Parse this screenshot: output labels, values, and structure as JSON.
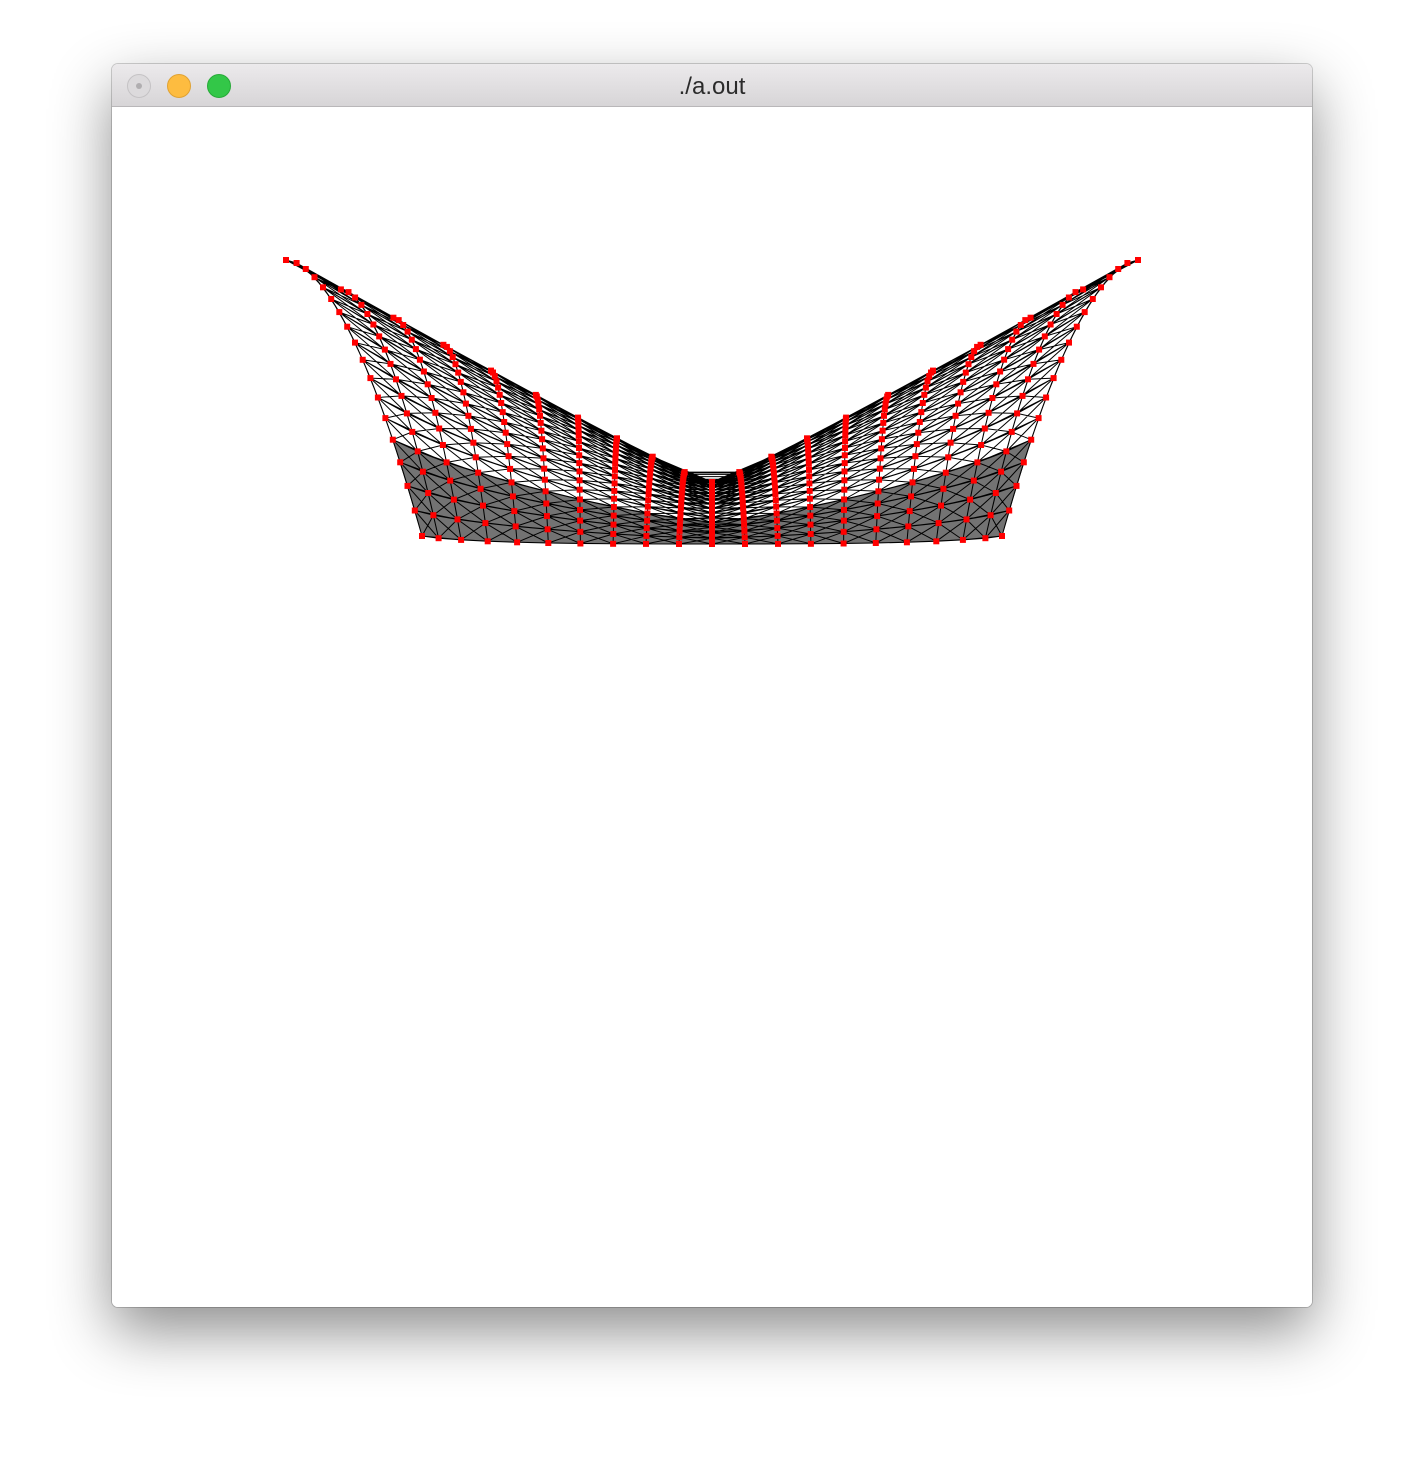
{
  "window": {
    "title": "./a.out"
  },
  "canvas": {
    "background": "#ffffff",
    "mesh_line_color": "#000000",
    "node_color": "#ff0000"
  }
}
